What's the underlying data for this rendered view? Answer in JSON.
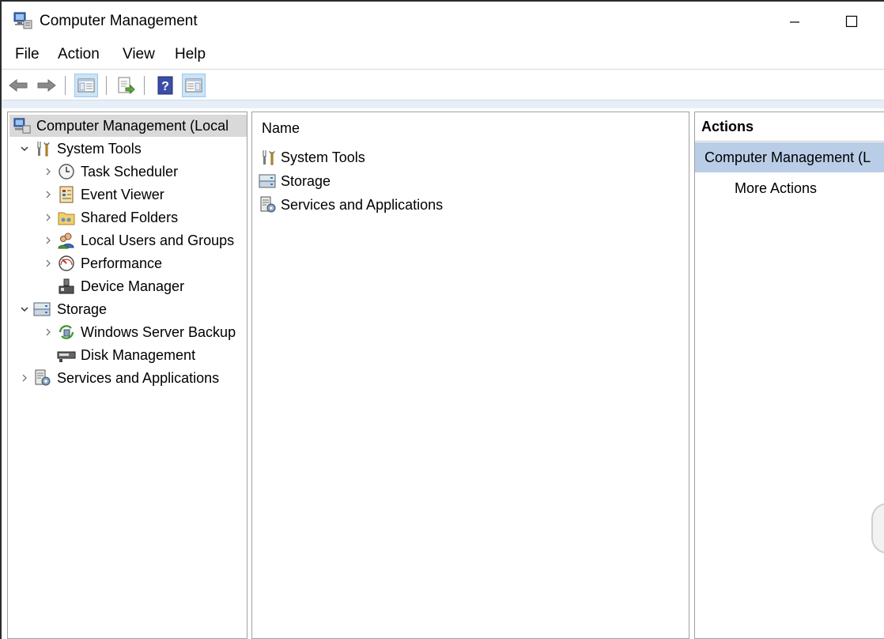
{
  "window": {
    "title": "Computer Management"
  },
  "menu": [
    "File",
    "Action",
    "View",
    "Help"
  ],
  "toolbar": {
    "icons": [
      "back-icon",
      "forward-icon",
      "show-hide-console-tree-icon",
      "export-list-icon",
      "help-icon",
      "show-hide-action-pane-icon"
    ]
  },
  "tree": {
    "root": "Computer Management (Local",
    "system_tools": "System Tools",
    "task_scheduler": "Task Scheduler",
    "event_viewer": "Event Viewer",
    "shared_folders": "Shared Folders",
    "local_users": "Local Users and Groups",
    "performance": "Performance",
    "device_manager": "Device Manager",
    "storage": "Storage",
    "wsb": "Windows Server Backup",
    "disk_management": "Disk Management",
    "services": "Services and Applications"
  },
  "list": {
    "header": "Name",
    "items": [
      "System Tools",
      "Storage",
      "Services and Applications"
    ]
  },
  "actions": {
    "header": "Actions",
    "section": "Computer Management (L",
    "more": "More Actions"
  },
  "colors": {
    "selected_section": "#b9cde6",
    "toolbar_active": "#cce4f7",
    "tree_selected": "#d9d9d9"
  }
}
